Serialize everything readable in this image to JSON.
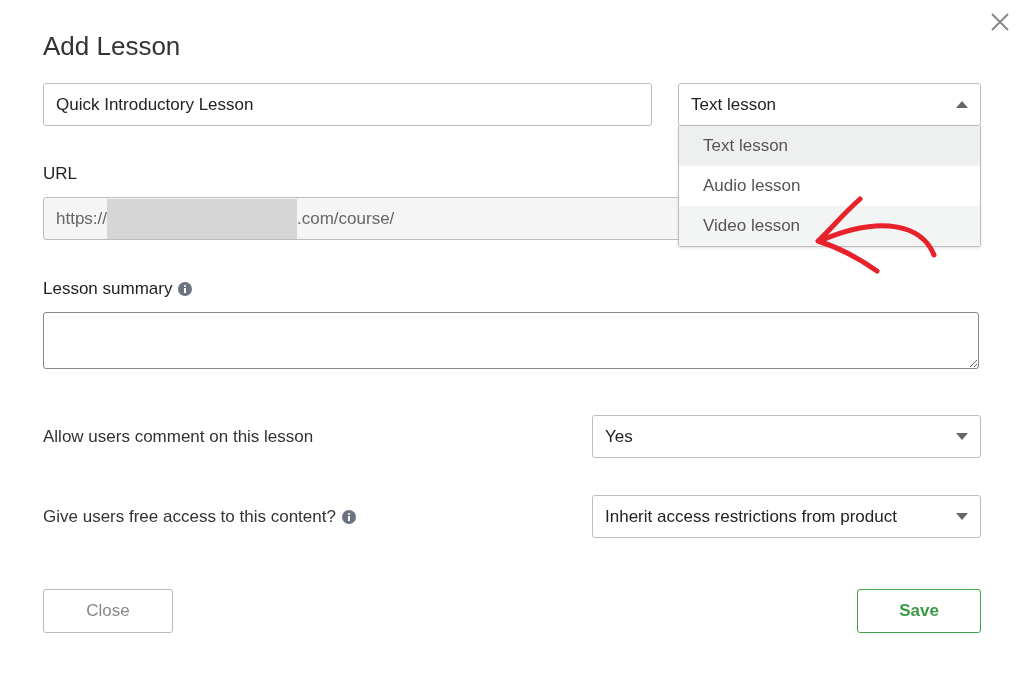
{
  "dialog": {
    "title": "Add Lesson"
  },
  "lesson_title": {
    "value": "Quick Introductory Lesson"
  },
  "lesson_type": {
    "value": "Text lesson",
    "expanded": true,
    "options": [
      {
        "label": "Text lesson",
        "selected": true,
        "hovered": false
      },
      {
        "label": "Audio lesson",
        "selected": false,
        "hovered": false
      },
      {
        "label": "Video lesson",
        "selected": false,
        "hovered": true
      }
    ]
  },
  "url": {
    "label": "URL",
    "prefix": "https://",
    "suffix": ".com/course/",
    "redacted": true
  },
  "summary": {
    "label": "Lesson summary"
  },
  "comments": {
    "label": "Allow users comment on this lesson",
    "value": "Yes"
  },
  "free_access": {
    "label": "Give users free access to this content?",
    "value": "Inherit access restrictions from product"
  },
  "buttons": {
    "close": "Close",
    "save": "Save"
  }
}
